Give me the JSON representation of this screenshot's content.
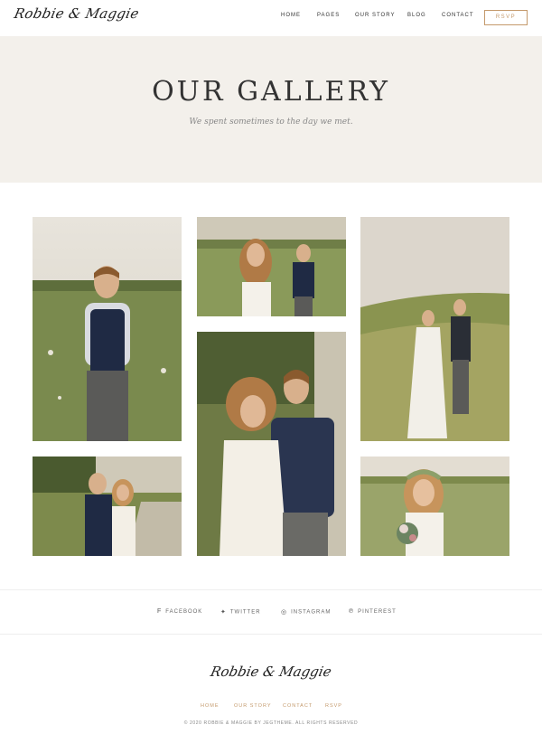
{
  "header": {
    "logo": "Robbie & Maggie",
    "nav": [
      {
        "label": "HOME"
      },
      {
        "label": "PAGES"
      },
      {
        "label": "OUR STORY"
      },
      {
        "label": "BLOG"
      },
      {
        "label": "CONTACT"
      }
    ],
    "rsvp_label": "RSVP"
  },
  "hero": {
    "title": "OUR GALLERY",
    "subtitle": "We spent sometimes to the day we met."
  },
  "social": [
    {
      "label": "FACEBOOK",
      "icon": "facebook-icon"
    },
    {
      "label": "TWITTER",
      "icon": "twitter-icon"
    },
    {
      "label": "INSTAGRAM",
      "icon": "instagram-icon"
    },
    {
      "label": "PINTEREST",
      "icon": "pinterest-icon"
    }
  ],
  "footer": {
    "logo": "Robbie & Maggie",
    "links": [
      {
        "label": "HOME"
      },
      {
        "label": "OUR STORY"
      },
      {
        "label": "CONTACT"
      },
      {
        "label": "RSVP"
      }
    ],
    "copyright": "© 2020 ROBBIE & MAGGIE BY JEGTHEME. ALL RIGHTS RESERVED"
  },
  "colors": {
    "accent": "#c49a6c",
    "hero_bg": "#f3f0eb"
  }
}
